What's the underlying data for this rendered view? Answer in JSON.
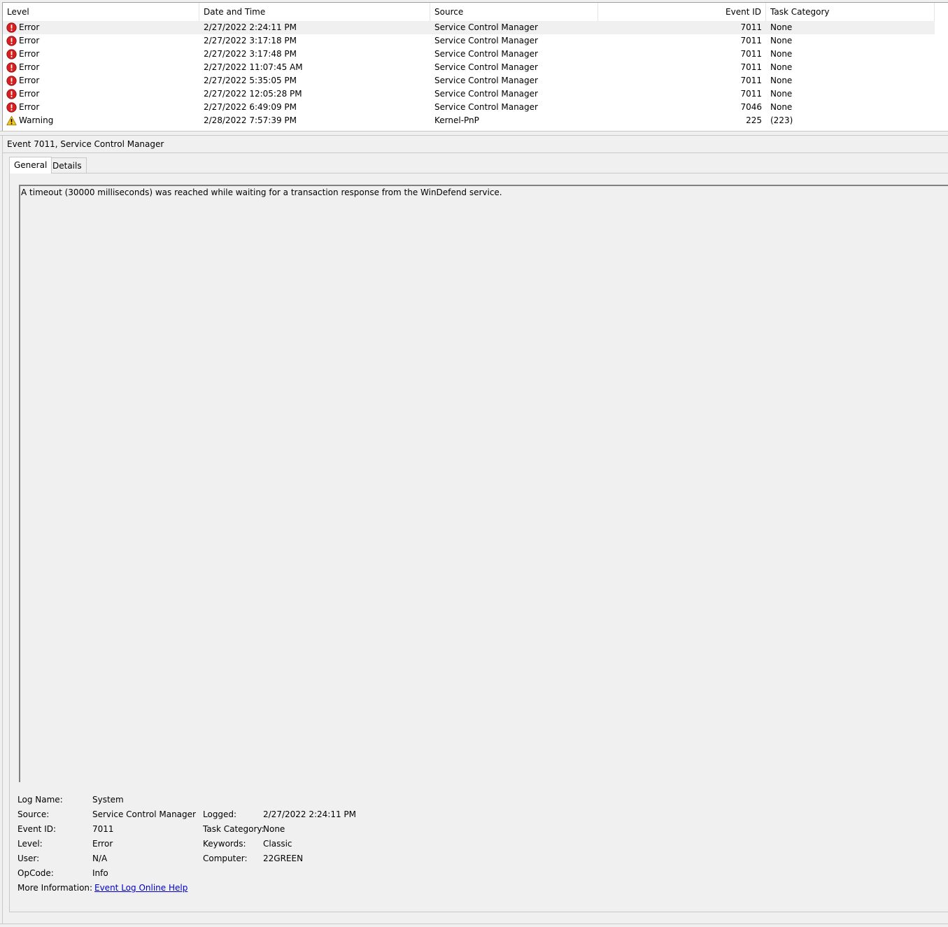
{
  "columns": {
    "level": "Level",
    "datetime": "Date and Time",
    "source": "Source",
    "eventid": "Event ID",
    "taskcat": "Task Category"
  },
  "events": [
    {
      "level": "Error",
      "icon": "error-icon",
      "datetime": "2/27/2022 2:24:11 PM",
      "source": "Service Control Manager",
      "eventid": "7011",
      "taskcat": "None",
      "selected": true
    },
    {
      "level": "Error",
      "icon": "error-icon",
      "datetime": "2/27/2022 3:17:18 PM",
      "source": "Service Control Manager",
      "eventid": "7011",
      "taskcat": "None"
    },
    {
      "level": "Error",
      "icon": "error-icon",
      "datetime": "2/27/2022 3:17:48 PM",
      "source": "Service Control Manager",
      "eventid": "7011",
      "taskcat": "None"
    },
    {
      "level": "Error",
      "icon": "error-icon",
      "datetime": "2/27/2022 11:07:45 AM",
      "source": "Service Control Manager",
      "eventid": "7011",
      "taskcat": "None"
    },
    {
      "level": "Error",
      "icon": "error-icon",
      "datetime": "2/27/2022 5:35:05 PM",
      "source": "Service Control Manager",
      "eventid": "7011",
      "taskcat": "None"
    },
    {
      "level": "Error",
      "icon": "error-icon",
      "datetime": "2/27/2022 12:05:28 PM",
      "source": "Service Control Manager",
      "eventid": "7011",
      "taskcat": "None"
    },
    {
      "level": "Error",
      "icon": "error-icon",
      "datetime": "2/27/2022 6:49:09 PM",
      "source": "Service Control Manager",
      "eventid": "7046",
      "taskcat": "None"
    },
    {
      "level": "Warning",
      "icon": "warning-icon",
      "datetime": "2/28/2022 7:57:39 PM",
      "source": "Kernel-PnP",
      "eventid": "225",
      "taskcat": "(223)"
    }
  ],
  "detail": {
    "title": "Event 7011, Service Control Manager",
    "tabs": [
      "General",
      "Details"
    ],
    "message": "A timeout (30000 milliseconds) was reached while waiting for a transaction response from the WinDefend service."
  },
  "props": {
    "log_name_label": "Log Name:",
    "log_name": "System",
    "source_label": "Source:",
    "source": "Service Control Manager",
    "event_id_label": "Event ID:",
    "event_id": "7011",
    "level_label": "Level:",
    "level": "Error",
    "user_label": "User:",
    "user": "N/A",
    "opcode_label": "OpCode:",
    "opcode": "Info",
    "more_info_label": "More Information:",
    "more_info_link": "Event Log Online Help",
    "logged_label": "Logged:",
    "logged": "2/27/2022 2:24:11 PM",
    "task_category_label": "Task Category:",
    "task_category": "None",
    "keywords_label": "Keywords:",
    "keywords": "Classic",
    "computer_label": "Computer:",
    "computer": "22GREEN"
  },
  "colors": {
    "error": "#d81e1e",
    "warning": "#f5c518",
    "link": "#0000cc"
  }
}
